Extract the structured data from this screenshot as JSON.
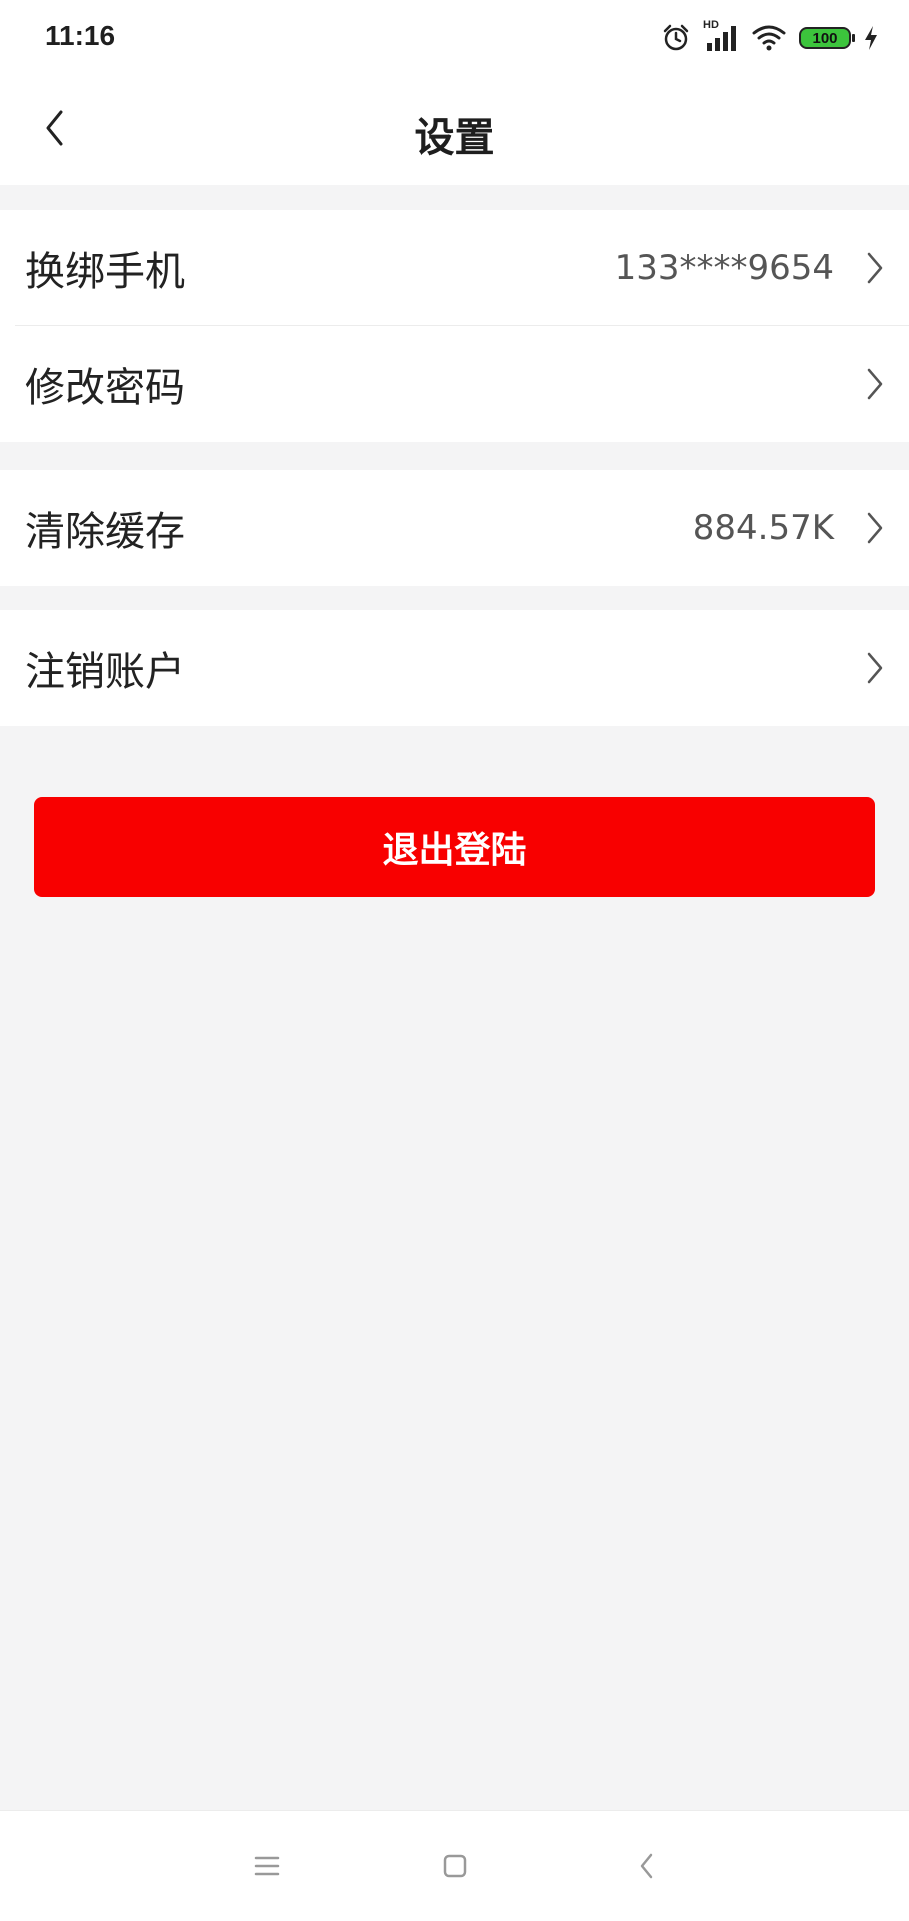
{
  "status_bar": {
    "time": "11:16",
    "network": "HD",
    "battery": "100",
    "battery_color": "#3cc43c"
  },
  "header": {
    "title": "设置",
    "back_icon": "chevron-left-icon"
  },
  "settings": {
    "rows": [
      {
        "label": "换绑手机",
        "value": "133****9654"
      },
      {
        "label": "修改密码",
        "value": ""
      },
      {
        "label": "清除缓存",
        "value": "884.57K"
      },
      {
        "label": "注销账户",
        "value": ""
      }
    ]
  },
  "logout": {
    "label": "退出登陆",
    "color": "#f80000"
  },
  "nav_bar": {
    "items": [
      "menu-icon",
      "home-square-icon",
      "back-icon"
    ]
  }
}
